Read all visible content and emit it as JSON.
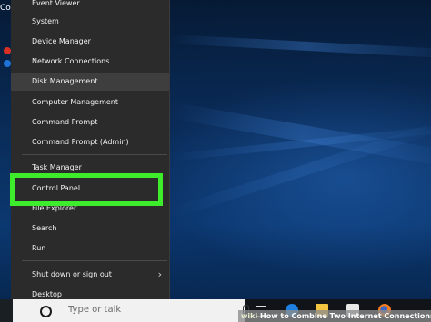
{
  "desktop": {
    "partial_icon_label": "Co"
  },
  "winx_menu": {
    "items": [
      {
        "label": "Event Viewer"
      },
      {
        "label": "System"
      },
      {
        "label": "Device Manager"
      },
      {
        "label": "Network Connections"
      },
      {
        "label": "Disk Management"
      },
      {
        "label": "Computer Management"
      },
      {
        "label": "Command Prompt"
      },
      {
        "label": "Command Prompt (Admin)"
      },
      {
        "label": "Task Manager"
      },
      {
        "label": "Control Panel"
      },
      {
        "label": "File Explorer"
      },
      {
        "label": "Search"
      },
      {
        "label": "Run"
      },
      {
        "label": "Shut down or sign out"
      },
      {
        "label": "Desktop"
      }
    ],
    "hovered_item": "Disk Management",
    "highlighted_item": "Control Panel",
    "highlight_color": "#3dec2a",
    "submenu_chevron_icon": "chevron-right-icon"
  },
  "taskbar": {
    "search_placeholder": "Type or talk",
    "icons": [
      "start-icon",
      "cortana-icon",
      "microphone-icon",
      "task-view-icon",
      "edge-icon",
      "file-explorer-icon",
      "store-icon",
      "firefox-icon"
    ]
  },
  "watermark": {
    "logo": "wiki",
    "text": "How to Combine Two Internet Connections"
  }
}
